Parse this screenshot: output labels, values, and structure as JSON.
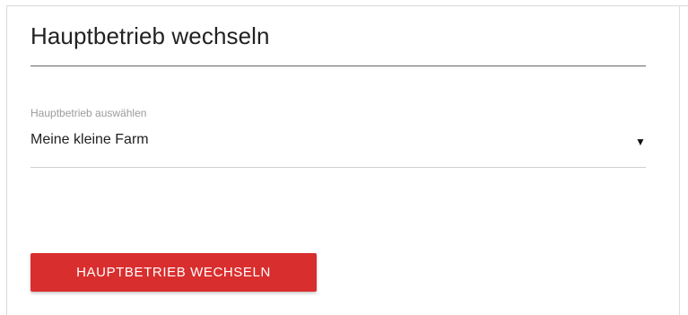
{
  "dialog": {
    "title": "Hauptbetrieb wechseln"
  },
  "select": {
    "label": "Hauptbetrieb auswählen",
    "value": "Meine kleine Farm",
    "arrow_icon": "▼"
  },
  "action": {
    "button_label": "HAUPTBETRIEB WECHSELN"
  },
  "colors": {
    "accent": "#d92e2e",
    "text": "#222222",
    "muted": "#9b9b9b"
  }
}
